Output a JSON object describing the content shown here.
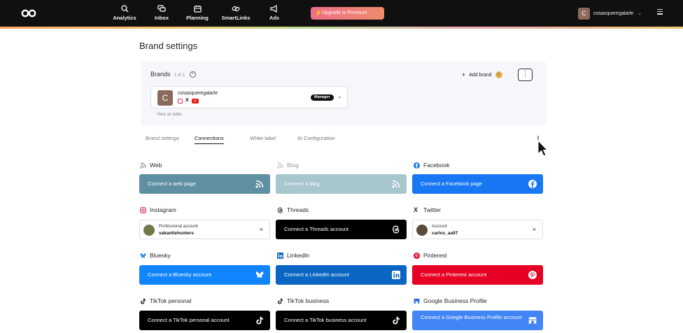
{
  "nav": {
    "items": [
      {
        "label": "Analytics",
        "icon": "analytics-icon"
      },
      {
        "label": "Inbox",
        "icon": "inbox-icon"
      },
      {
        "label": "Planning",
        "icon": "planning-icon"
      },
      {
        "label": "SmartLinks",
        "icon": "link-icon"
      },
      {
        "label": "Ads",
        "icon": "megaphone-icon"
      }
    ],
    "upgrade_label": "Upgrade to Premium",
    "account_initial": "C",
    "account_name": "cosasqueregalarle"
  },
  "page": {
    "title": "Brand settings"
  },
  "brands": {
    "heading": "Brands",
    "count": "1 of 1",
    "add_label": "Add brand",
    "more_label": "⋮",
    "card": {
      "initial": "C",
      "name": "cosasqueregalarle",
      "role": "Manager"
    },
    "view_table_label": "View as table"
  },
  "tabs": [
    {
      "label": "Brand settings",
      "active": false
    },
    {
      "label": "Connections",
      "active": true
    },
    {
      "label": "White label",
      "active": false
    },
    {
      "label": "AI Configuration",
      "active": false
    }
  ],
  "connections": {
    "web": {
      "label": "Web",
      "button": "Connect a web page",
      "color": "#5e8fa3"
    },
    "blog": {
      "label": "Blog",
      "button": "Connect a blog",
      "color": "#a6c7cc"
    },
    "facebook": {
      "label": "Facebook",
      "button": "Connect a Facebook page",
      "color": "#1877f2"
    },
    "instagram": {
      "label": "Instagram",
      "account_kind": "Professional account",
      "account_user": "vakantiehunters",
      "close": "×"
    },
    "threads": {
      "label": "Threads",
      "button": "Connect a Threads account",
      "color": "#000000"
    },
    "twitter": {
      "label": "Twitter",
      "account_kind": "Account",
      "account_user": "carlos_aa97",
      "close": "×"
    },
    "bluesky": {
      "label": "Bluesky",
      "button": "Connect a Bluesky account",
      "color": "#1185fe"
    },
    "linkedin": {
      "label": "LinkedIn",
      "button": "Connect a LinkedIn account",
      "color": "#0a66c2"
    },
    "pinterest": {
      "label": "Pinterest",
      "button": "Connect a Pinterest account",
      "color": "#e60023"
    },
    "tiktok_personal": {
      "label": "TikTok personal",
      "button": "Connect a TikTok personal account",
      "color": "#000000"
    },
    "tiktok_business": {
      "label": "TikTok business",
      "button": "Connect a TikTok business account",
      "color": "#000000"
    },
    "google_business": {
      "label": "Google Business Profile",
      "button": "Connect a Google Business Profile account",
      "color": "#4285f4"
    }
  }
}
